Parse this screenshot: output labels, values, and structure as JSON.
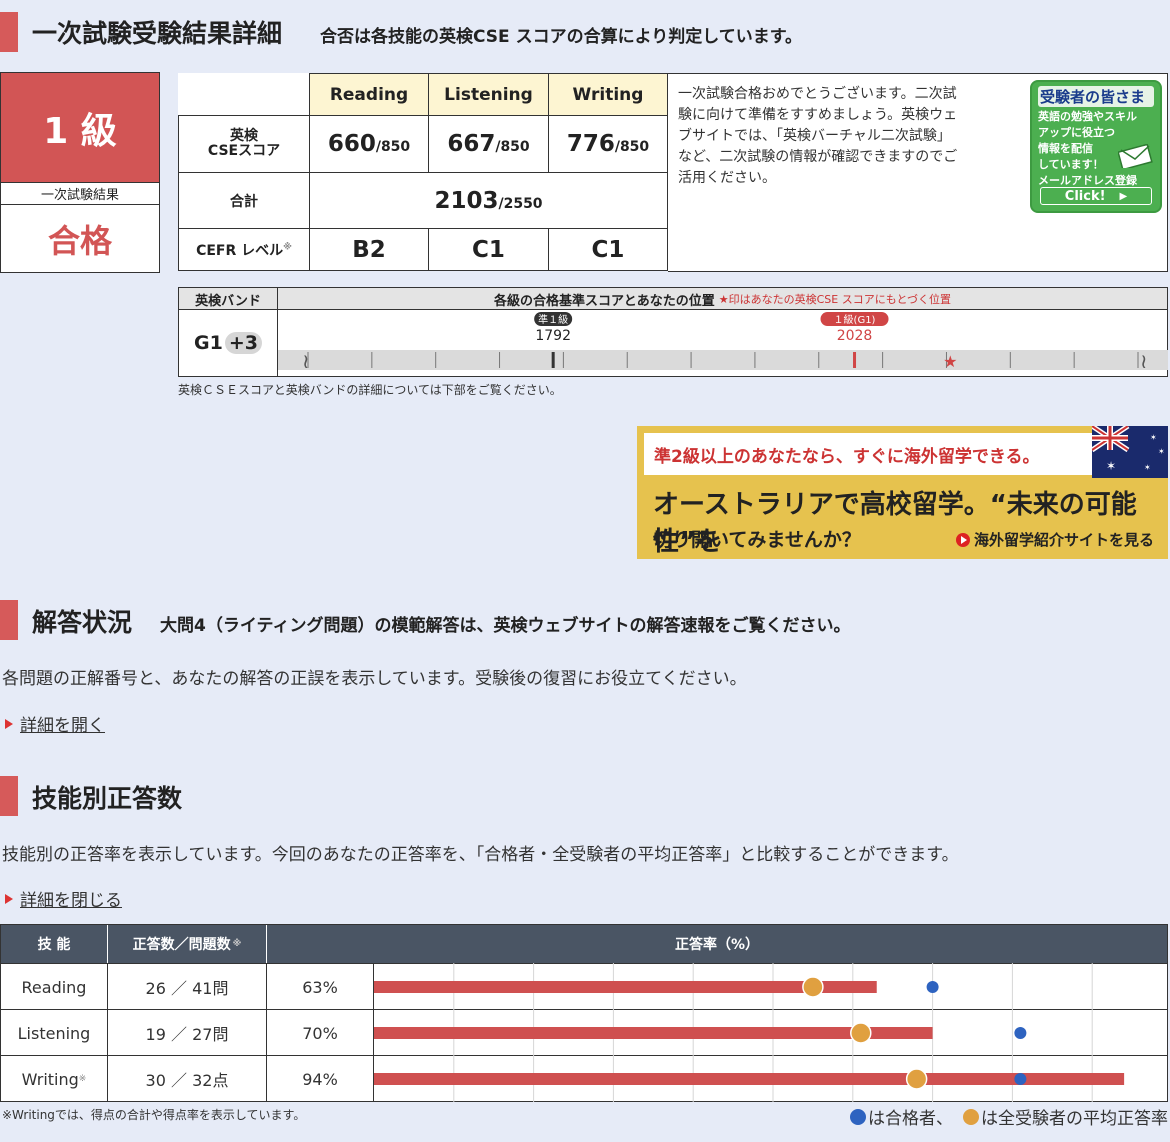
{
  "section1": {
    "title": "一次試験受験結果詳細",
    "subtitle": "合否は各技能の英検CSE スコアの合算により判定しています。"
  },
  "grade": {
    "level": "1 級",
    "result_label": "一次試験結果",
    "result": "合格"
  },
  "score_table": {
    "headers": [
      "Reading",
      "Listening",
      "Writing"
    ],
    "cse_label": "英検\nCSEスコア",
    "scores": [
      {
        "value": "660",
        "max": "/850"
      },
      {
        "value": "667",
        "max": "/850"
      },
      {
        "value": "776",
        "max": "/850"
      }
    ],
    "total_label": "合計",
    "total": {
      "value": "2103",
      "max": "/2550"
    },
    "cefr_label": "CEFR レベル",
    "cefr_mark": "※",
    "cefr": [
      "B2",
      "C1",
      "C1"
    ]
  },
  "pass_message": "一次試験合格おめでとうございます。二次試験に向けて準備をすすめましょう。英検ウェブサイトでは、「英検バーチャル二次試験」など、二次試験の情報が確認できますのでご活用ください。",
  "mail_banner": {
    "title": "受験者の皆さま",
    "lines": [
      "英語の勉強やスキル",
      "アップに役立つ",
      "情報を配信",
      "しています！",
      "メールアドレス登録"
    ],
    "click": "Click!"
  },
  "band": {
    "header_left": "英検バンド",
    "header_right": "各級の合格基準スコアとあなたの位置",
    "header_note": "★印はあなたの英検CSE スコアにもとづく位置",
    "band_value": "G1",
    "band_offset": "+3",
    "markers": [
      {
        "label": "準１級",
        "score": "1792",
        "color": "#333333"
      },
      {
        "label": "１級(G1)",
        "score": "2028",
        "color": "#d04545"
      }
    ],
    "scale": {
      "min": 1600,
      "max": 2250,
      "ticks_step": 50
    },
    "you": 2103,
    "note": "英検ＣＳＥスコアと英検バンドの詳細については下部をご覧ください。"
  },
  "promo": {
    "top": "準2級以上のあなたなら、すぐに海外留学できる。",
    "line1": "オーストラリアで高校留学。“未来の可能性”を",
    "line2": "切り開いてみませんか？",
    "link": "海外留学紹介サイトを見る"
  },
  "section2": {
    "title": "解答状況",
    "subtitle": "大問4（ライティング問題）の模範解答は、英検ウェブサイトの解答速報をご覧ください。",
    "desc": "各問題の正解番号と、あなたの解答の正誤を表示しています。受験後の復習にお役立てください。",
    "toggle": "詳細を開く"
  },
  "section3": {
    "title": "技能別正答数",
    "desc": "技能別の正答率を表示しています。今回のあなたの正答率を、「合格者・全受験者の平均正答率」と比較することができます。",
    "toggle": "詳細を閉じる"
  },
  "skills": {
    "headers": [
      "技 能",
      "正答数／問題数",
      "※",
      "正答率（%）"
    ],
    "rows": [
      {
        "skill": "Reading",
        "mark": "",
        "count": "26 ／ 41問",
        "rate": "63%",
        "value": 63,
        "all_avg": 55,
        "pass_avg": 70
      },
      {
        "skill": "Listening",
        "mark": "",
        "count": "19 ／ 27問",
        "rate": "70%",
        "value": 70,
        "all_avg": 61,
        "pass_avg": 81
      },
      {
        "skill": "Writing",
        "mark": "※",
        "count": "30 ／ 32点",
        "rate": "94%",
        "value": 94,
        "all_avg": 68,
        "pass_avg": 81
      }
    ],
    "note": "※Writingでは、得点の合計や得点率を表示しています。",
    "legend_pass": "は合格者、",
    "legend_all": "は全受験者の平均正答率",
    "colors": {
      "bar": "#cf5050",
      "pass": "#2e63c0",
      "all": "#e0a040"
    }
  }
}
